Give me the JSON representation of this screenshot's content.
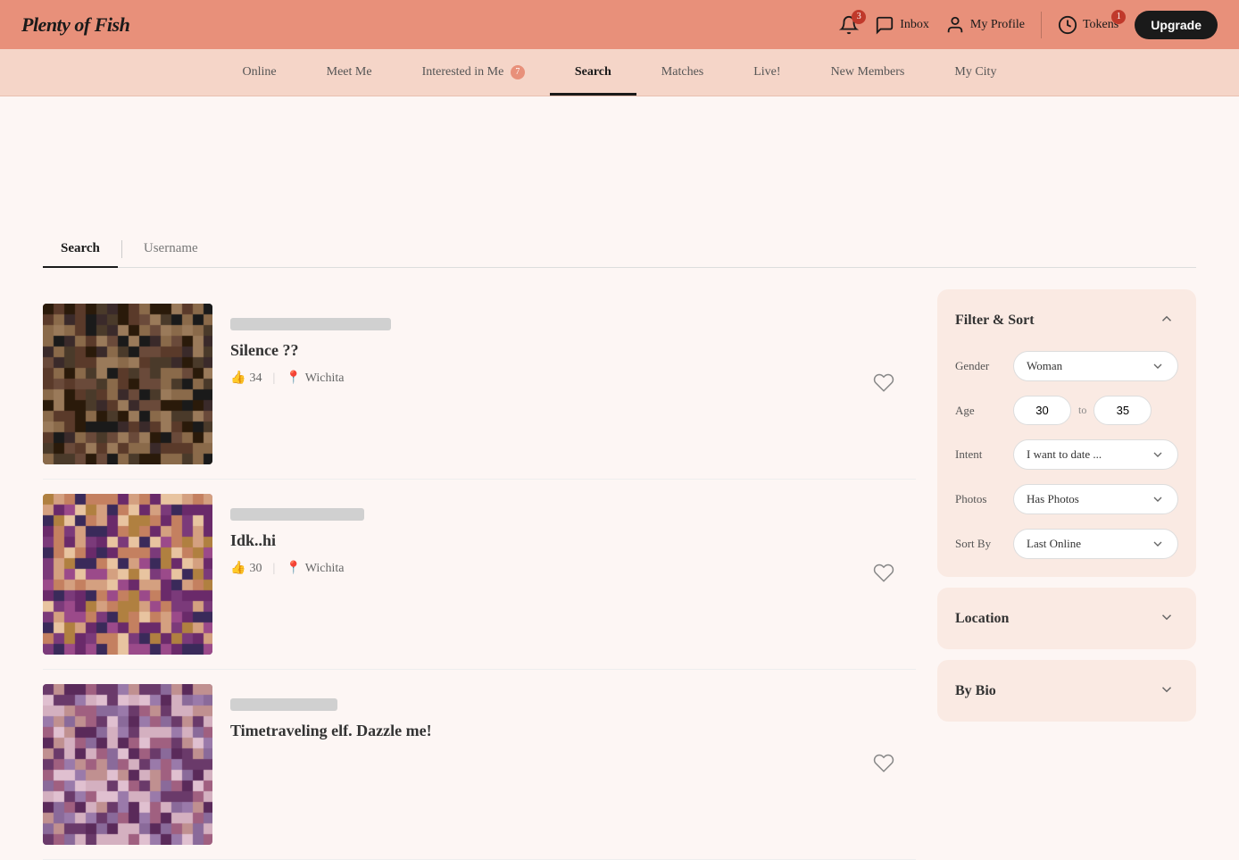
{
  "header": {
    "logo": "Plenty of Fish",
    "notifications_count": "3",
    "inbox_label": "Inbox",
    "profile_label": "My Profile",
    "tokens_label": "Tokens",
    "tokens_count": "1",
    "upgrade_label": "Upgrade"
  },
  "nav": {
    "items": [
      {
        "id": "online",
        "label": "Online",
        "active": false,
        "badge": null
      },
      {
        "id": "meet-me",
        "label": "Meet Me",
        "active": false,
        "badge": null
      },
      {
        "id": "interested",
        "label": "Interested in Me",
        "active": false,
        "badge": "7"
      },
      {
        "id": "search",
        "label": "Search",
        "active": true,
        "badge": null
      },
      {
        "id": "matches",
        "label": "Matches",
        "active": false,
        "badge": null
      },
      {
        "id": "live",
        "label": "Live!",
        "active": false,
        "badge": null
      },
      {
        "id": "new-members",
        "label": "New Members",
        "active": false,
        "badge": null
      },
      {
        "id": "my-city",
        "label": "My City",
        "active": false,
        "badge": null
      }
    ]
  },
  "search_tabs": {
    "tabs": [
      {
        "id": "search",
        "label": "Search",
        "active": true
      },
      {
        "id": "username",
        "label": "Username",
        "active": false
      }
    ]
  },
  "results": [
    {
      "id": 1,
      "name": "Silence ??",
      "age": "34",
      "location": "Wichita",
      "photo_class": "photo-1"
    },
    {
      "id": 2,
      "name": "Idk..hi",
      "age": "30",
      "location": "Wichita",
      "photo_class": "photo-2"
    },
    {
      "id": 3,
      "name": "Timetraveling elf. Dazzle me!",
      "age": "",
      "location": "",
      "photo_class": "photo-3"
    }
  ],
  "filter": {
    "title": "Filter & Sort",
    "gender_label": "Gender",
    "gender_value": "Woman",
    "age_label": "Age",
    "age_from": "30",
    "age_to": "35",
    "age_to_text": "to",
    "intent_label": "Intent",
    "intent_value": "I want to date ...",
    "photos_label": "Photos",
    "photos_value": "Has Photos",
    "sort_label": "Sort By",
    "sort_value": "Last Online"
  },
  "location": {
    "title": "Location"
  },
  "bio": {
    "title": "By Bio"
  }
}
